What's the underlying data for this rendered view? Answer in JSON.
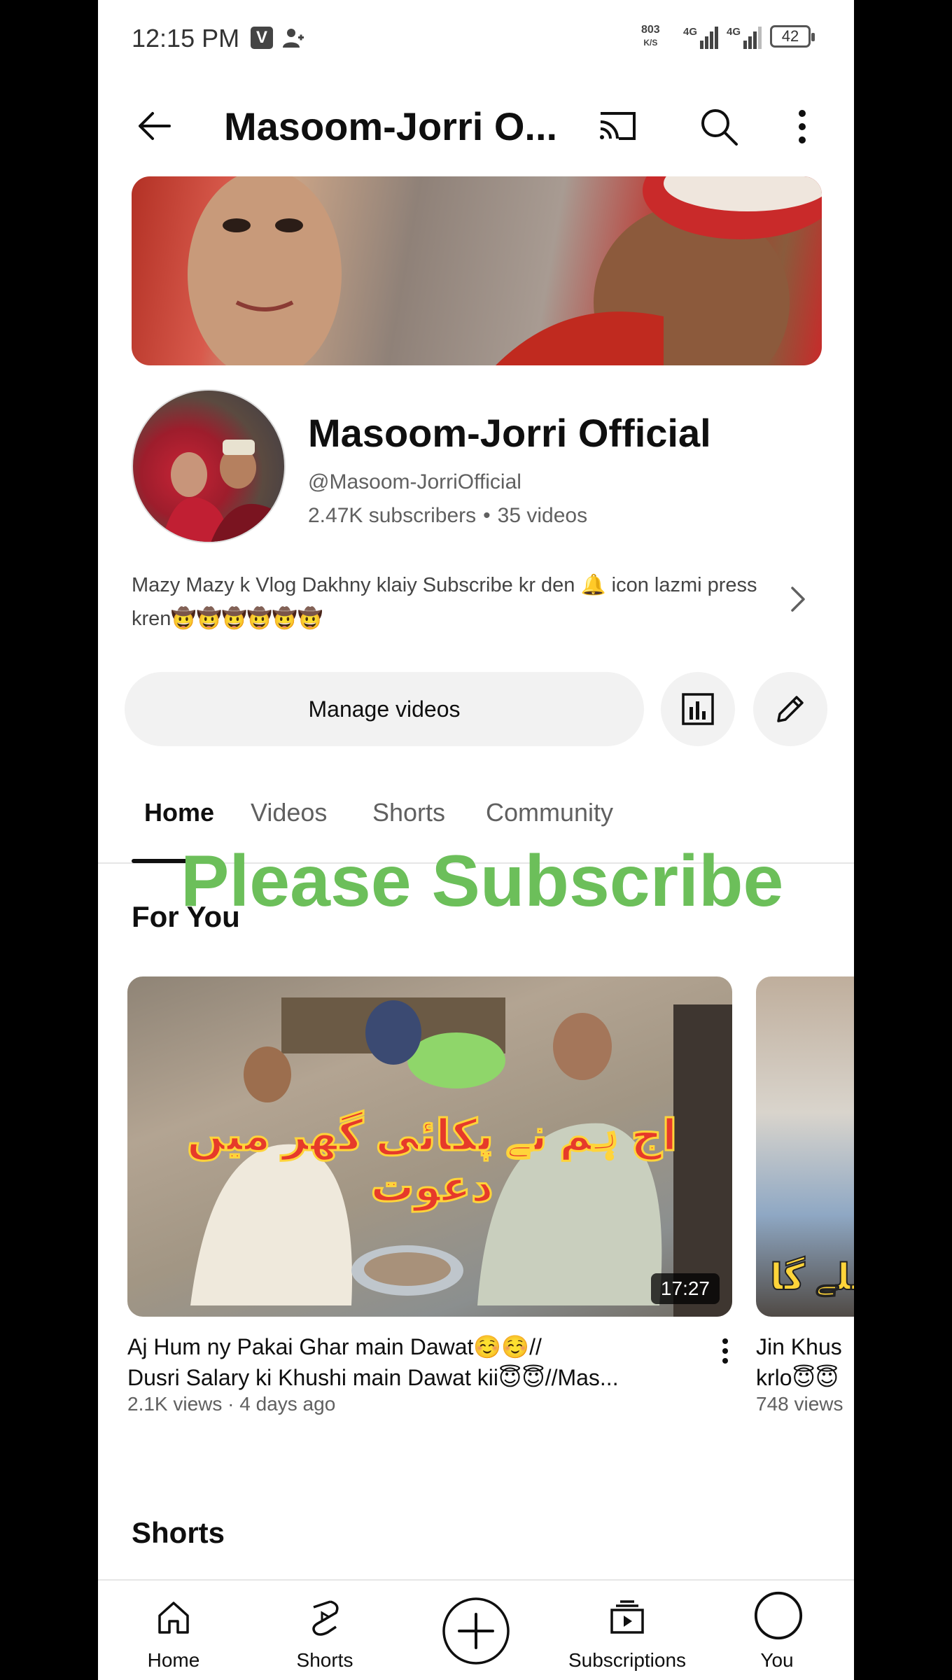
{
  "status_bar": {
    "time": "12:15 PM",
    "speed_top": "803",
    "speed_bottom": "K/S",
    "network1": "4G",
    "network2": "4G",
    "battery": "42"
  },
  "app_bar": {
    "title": "Masoom-Jorri O..."
  },
  "channel": {
    "name": "Masoom-Jorri Official",
    "handle": "@Masoom-JorriOfficial",
    "subscribers": "2.47K subscribers",
    "separator": "•",
    "videos": "35 videos",
    "description": "Mazy Mazy k Vlog Dakhny klaiy Subscribe kr den 🔔 icon lazmi press kren🤠🤠🤠🤠🤠🤠"
  },
  "actions": {
    "manage_videos": "Manage videos"
  },
  "tabs": [
    {
      "label": "Home",
      "active": true
    },
    {
      "label": "Videos",
      "active": false
    },
    {
      "label": "Shorts",
      "active": false
    },
    {
      "label": "Community",
      "active": false
    }
  ],
  "overlay_text": "Please Subscribe",
  "for_you": {
    "heading": "For You",
    "videos": [
      {
        "thumbnail_overlay": "اج ہم نے پکائی گھر میں دعوت",
        "duration": "17:27",
        "title_line1": "Aj Hum ny Pakai Ghar main Dawat☺️☺️//",
        "title_line2": "Dusri Salary ki Khushi main Dawat kii😇😇//Mas...",
        "meta": "2.1K views · 4 days ago"
      },
      {
        "thumbnail_overlay": "ملے گا",
        "title_line1": "Jin Khus",
        "title_line2": "krlo😇😇",
        "meta": "748 views"
      }
    ]
  },
  "shorts_heading": "Shorts",
  "bottom_nav": {
    "home": "Home",
    "shorts": "Shorts",
    "subscriptions": "Subscriptions",
    "you": "You"
  }
}
